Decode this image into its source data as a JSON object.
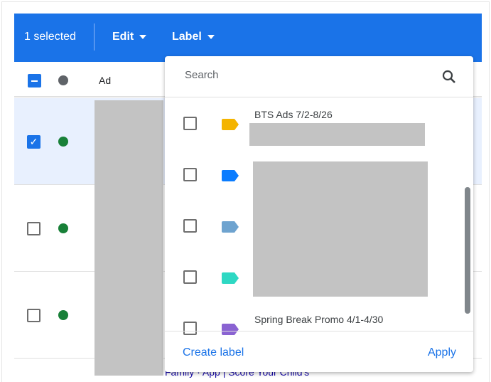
{
  "toolbar": {
    "selected_text": "1 selected",
    "edit_label": "Edit",
    "label_label": "Label",
    "color": "#1a73e8"
  },
  "table": {
    "header": {
      "ad_label": "Ad"
    },
    "rows": [
      {
        "selected": true,
        "status": "enabled"
      },
      {
        "selected": false,
        "status": "enabled"
      },
      {
        "selected": false,
        "status": "enabled"
      }
    ],
    "status_color": "#188038",
    "peek_text": "Family · App | Score Your Child's"
  },
  "label_menu": {
    "search_placeholder": "Search",
    "items": [
      {
        "name": "BTS Ads 7/2-8/26",
        "color": "#f4b400",
        "checked": false
      },
      {
        "name": "",
        "color": "#0a7cff",
        "checked": false
      },
      {
        "name": "",
        "color": "#6ea3cf",
        "checked": false
      },
      {
        "name": "",
        "color": "#2ed8c3",
        "checked": false
      },
      {
        "name": "Spring Break Promo 4/1-4/30",
        "color": "#8a63d2",
        "checked": false
      }
    ],
    "create_label": "Create label",
    "apply_label": "Apply"
  }
}
